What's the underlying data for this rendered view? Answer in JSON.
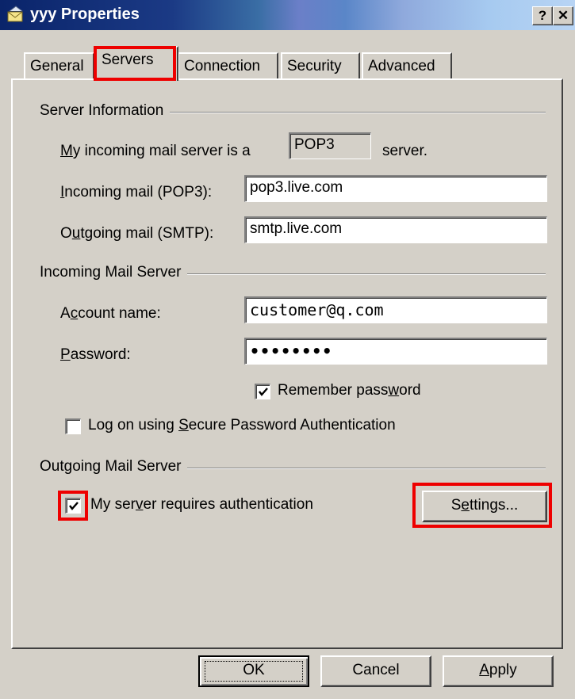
{
  "window": {
    "title": "yyy Properties",
    "help_label": "?",
    "close_label": "✕"
  },
  "tabs": [
    {
      "label": "General"
    },
    {
      "label": "Servers",
      "active": true
    },
    {
      "label": "Connection"
    },
    {
      "label": "Security"
    },
    {
      "label": "Advanced"
    }
  ],
  "server_info": {
    "group_label": "Server Information",
    "incoming_type_prefix": "y incoming mail server is a",
    "incoming_type_accel": "M",
    "incoming_type_value": "POP3",
    "incoming_type_suffix": "server.",
    "incoming_label_accel": "I",
    "incoming_label_rest": "ncoming mail (POP3):",
    "incoming_value": "pop3.live.com",
    "outgoing_label_pre": "O",
    "outgoing_label_accel": "u",
    "outgoing_label_rest": "tgoing mail (SMTP):",
    "outgoing_value": "smtp.live.com"
  },
  "incoming_server": {
    "group_label": "Incoming Mail Server",
    "account_label_pre": "A",
    "account_label_accel": "c",
    "account_label_rest": "count name:",
    "account_value": "customer@q.com",
    "password_label_accel": "P",
    "password_label_rest": "assword:",
    "password_value": "••••••••",
    "remember_label_pre": "Remember pass",
    "remember_label_accel": "w",
    "remember_label_rest": "ord",
    "remember_checked": true,
    "spa_label_pre": "Log on using ",
    "spa_label_accel": "S",
    "spa_label_rest": "ecure Password Authentication",
    "spa_checked": false
  },
  "outgoing_server": {
    "group_label": "Outgoing Mail Server",
    "auth_label_pre": "My ser",
    "auth_label_accel": "v",
    "auth_label_rest": "er requires authentication",
    "auth_checked": true,
    "settings_pre": "S",
    "settings_accel": "e",
    "settings_rest": "ttings..."
  },
  "buttons": {
    "ok_label": "OK",
    "cancel_label": "Cancel",
    "apply_accel": "A",
    "apply_rest": "pply"
  },
  "colors": {
    "highlight": "#ee0000",
    "title_bar": "#0a246a"
  }
}
